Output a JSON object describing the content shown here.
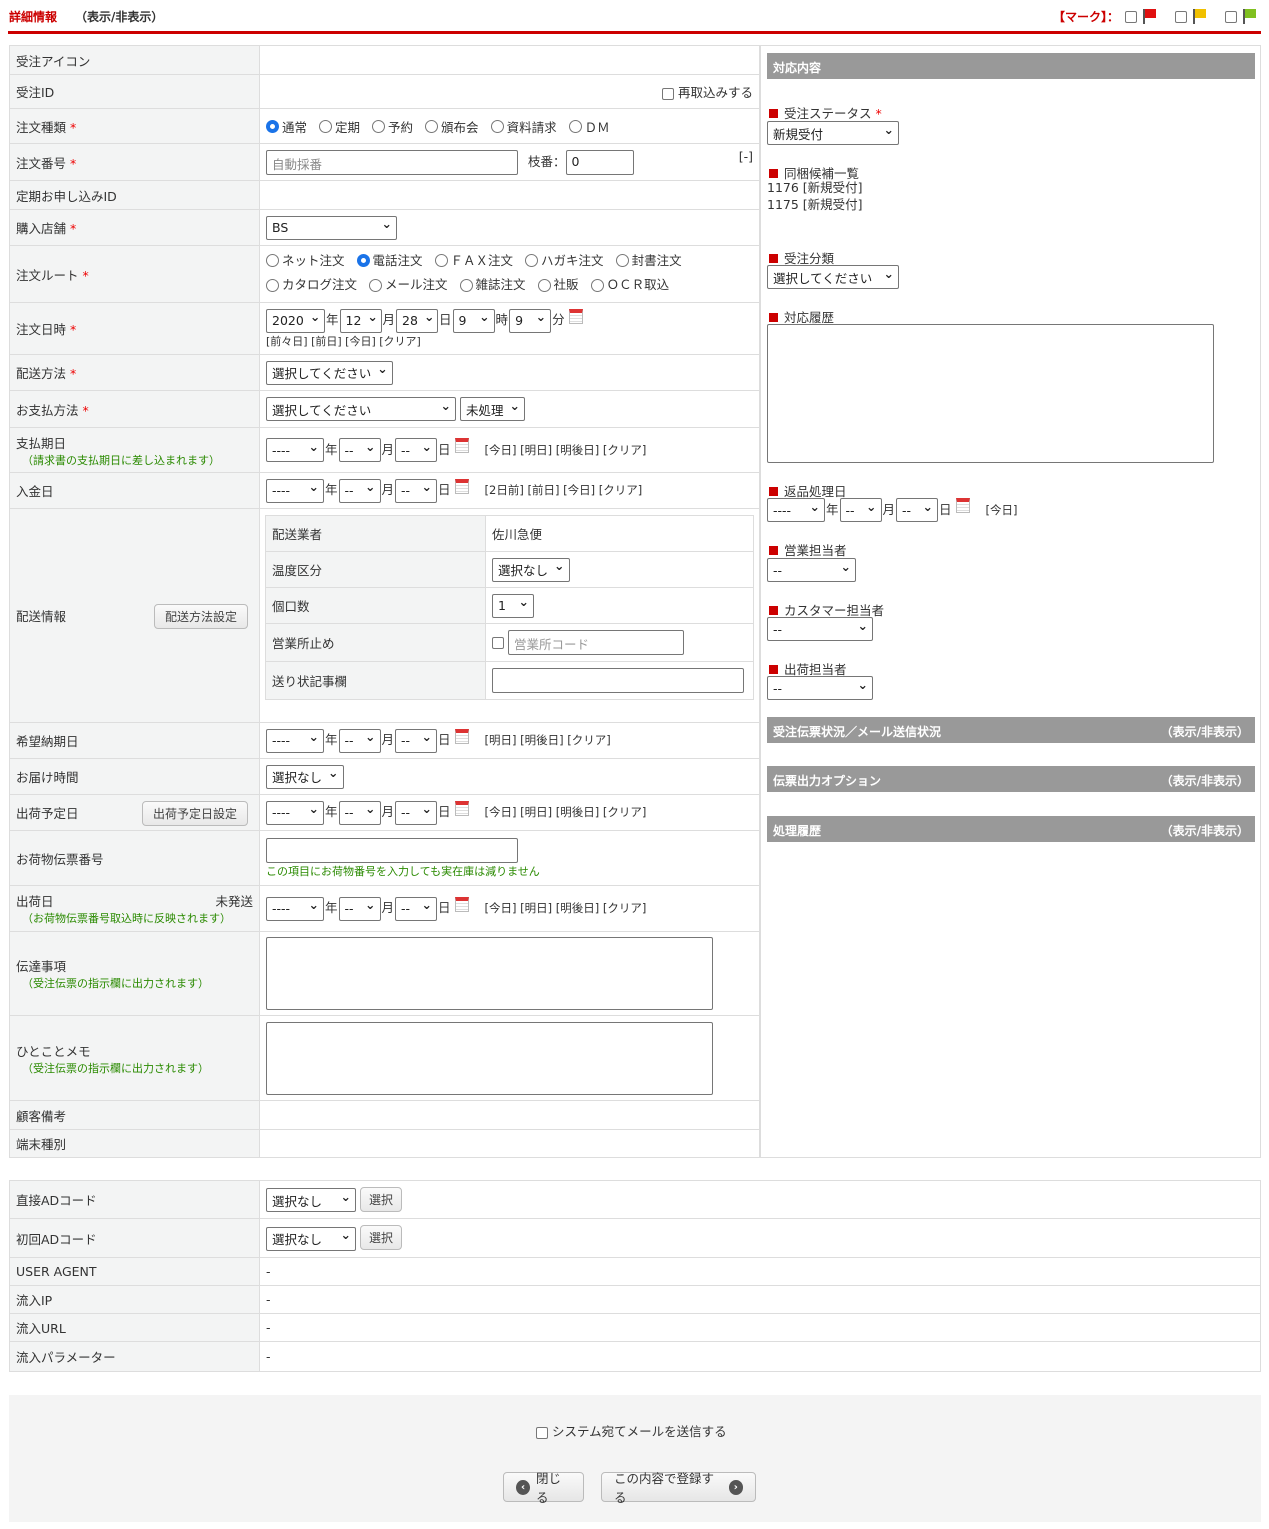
{
  "header": {
    "title": "詳細情報",
    "toggle": "（表示/非表示）",
    "mark_label": "【マーク】：",
    "mark_colors": [
      "#e01010",
      "#f0c000",
      "#80c020"
    ]
  },
  "units": {
    "year": "年",
    "month": "月",
    "day": "日",
    "hour": "時",
    "minute": "分"
  },
  "form": {
    "order_icon": {
      "label": "受注アイコン"
    },
    "order_id": {
      "label": "受注ID",
      "reimport": "再取込みする"
    },
    "order_type": {
      "label": "注文種類",
      "options": [
        "通常",
        "定期",
        "予約",
        "頒布会",
        "資料請求",
        "ＤＭ"
      ],
      "selected": "通常"
    },
    "order_no": {
      "label": "注文番号",
      "placeholder": "自動採番",
      "branch_label": "枝番：",
      "branch_value": "0",
      "toggle": "[-]"
    },
    "subscription_id": {
      "label": "定期お申し込みID"
    },
    "store": {
      "label": "購入店舗",
      "value": "BS"
    },
    "route": {
      "label": "注文ルート",
      "options": [
        "ネット注文",
        "電話注文",
        "ＦＡＸ注文",
        "ハガキ注文",
        "封書注文",
        "カタログ注文",
        "メール注文",
        "雑誌注文",
        "社販",
        "ＯＣＲ取込"
      ],
      "selected": "電話注文"
    },
    "order_date": {
      "label": "注文日時",
      "year": "2020",
      "month": "12",
      "day": "28",
      "hour": "9",
      "minute": "9",
      "links": "[前々日] [前日] [今日] [クリア]"
    },
    "delivery_method": {
      "label": "配送方法",
      "value": "選択してください"
    },
    "payment_method": {
      "label": "お支払方法",
      "value": "選択してください",
      "status": "未処理"
    },
    "payment_due": {
      "label": "支払期日",
      "note": "（請求書の支払期日に差し込まれます）",
      "links": "[今日] [明日] [明後日] [クリア]"
    },
    "deposit_date": {
      "label": "入金日",
      "links": "[2日前] [前日] [今日] [クリア]"
    },
    "shipping": {
      "label": "配送情報",
      "button": "配送方法設定",
      "carrier_label": "配送業者",
      "carrier": "佐川急便",
      "temp_label": "温度区分",
      "temp": "選択なし",
      "boxes_label": "個口数",
      "boxes": "1",
      "office_label": "営業所止め",
      "office_placeholder": "営業所コード",
      "slip_note_label": "送り状記事欄"
    },
    "desired_date": {
      "label": "希望納期日",
      "links": "[明日] [明後日] [クリア]"
    },
    "delivery_time": {
      "label": "お届け時間",
      "value": "選択なし"
    },
    "ship_plan": {
      "label": "出荷予定日",
      "button": "出荷予定日設定",
      "links": "[今日] [明日] [明後日] [クリア]"
    },
    "tracking": {
      "label": "お荷物伝票番号",
      "note": "この項目にお荷物番号を入力しても実在庫は減りません"
    },
    "ship_date": {
      "label": "出荷日",
      "status": "未発送",
      "note": "（お荷物伝票番号取込時に反映されます）",
      "links": "[今日] [明日] [明後日] [クリア]"
    },
    "message": {
      "label": "伝達事項",
      "note": "（受注伝票の指示欄に出力されます）"
    },
    "memo": {
      "label": "ひとことメモ",
      "note": "（受注伝票の指示欄に出力されます）"
    },
    "customer_note": {
      "label": "顧客備考"
    },
    "device": {
      "label": "端末種別"
    },
    "empty_date": {
      "year": "----",
      "month": "--",
      "day": "--"
    }
  },
  "right": {
    "title": "対応内容",
    "status_label": "受注ステータス",
    "status": "新規受付",
    "bundle_label": "同梱候補一覧",
    "bundle": [
      "1176 [新規受付]",
      "1175 [新規受付]"
    ],
    "category_label": "受注分類",
    "category": "選択してください",
    "history_label": "対応履歴",
    "return_label": "返品処理日",
    "return_links": "[今日]",
    "sales_label": "営業担当者",
    "cs_label": "カスタマー担当者",
    "ship_staff_label": "出荷担当者",
    "staff_value": "--",
    "sections": [
      {
        "title": "受注伝票状況／メール送信状況",
        "toggle": "（表示/非表示）"
      },
      {
        "title": "伝票出力オプション",
        "toggle": "（表示/非表示）"
      },
      {
        "title": "処理履歴",
        "toggle": "（表示/非表示）"
      }
    ]
  },
  "ad": {
    "direct_label": "直接ADコード",
    "first_label": "初回ADコード",
    "select_value": "選択なし",
    "select_button": "選択",
    "rows": [
      {
        "label": "USER AGENT",
        "value": "-"
      },
      {
        "label": "流入IP",
        "value": "-"
      },
      {
        "label": "流入URL",
        "value": "-"
      },
      {
        "label": "流入パラメーター",
        "value": "-"
      }
    ]
  },
  "footer": {
    "send_mail": "システム宛てメールを送信する",
    "close": "閉じる",
    "register": "この内容で登録する"
  }
}
